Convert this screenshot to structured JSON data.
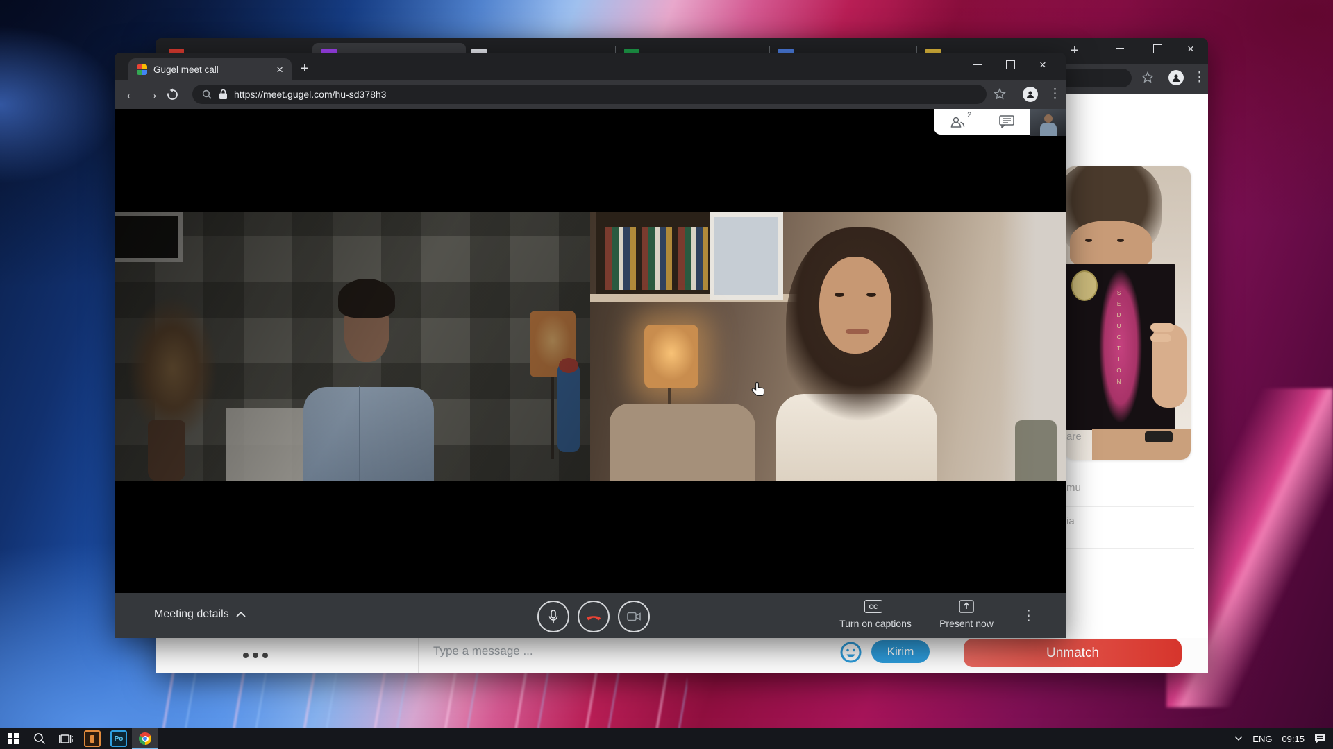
{
  "meet_window": {
    "tab_title": "Gugel meet call",
    "url": "https://meet.gugel.com/hu-sd378h3",
    "participants_count": "2",
    "bottom_bar": {
      "meeting_details_label": "Meeting details",
      "captions_label": "Turn on captions",
      "captions_icon_text": "CC",
      "present_label": "Present now"
    }
  },
  "back_window": {
    "tab_favicon_colors": [
      "#e03c31",
      "#a142f4",
      "#e8eaf0",
      "#1e9e4a",
      "#4b7de0",
      "#e0b93c"
    ],
    "profile_card": {
      "book_title": "SEDUCTION"
    },
    "list_items_clipped": [
      "are",
      "mu",
      "ia"
    ],
    "chat": {
      "typing_indicator_dots": 3,
      "message_placeholder": "Type a message ...",
      "send_label": "Kirim",
      "unmatch_label": "Unmatch"
    },
    "colors": {
      "send_blue": "#2D9CDB",
      "unmatch_red": "#DC4237"
    }
  },
  "taskbar": {
    "language": "ENG",
    "time": "09:15",
    "app_po_label": "Po",
    "app_icons": [
      "windows-start",
      "search",
      "task-view",
      "app-orange",
      "app-po",
      "chrome"
    ],
    "active_app": "chrome"
  },
  "glyphs": {
    "back_arrow": "←",
    "forward_arrow": "→",
    "tab_close": "×",
    "new_tab": "+",
    "kebab": "⋮"
  },
  "colors": {
    "browser_frame": "#202124",
    "browser_toolbar": "#35363a",
    "meet_bottom_bar": "#35383c",
    "hangup_red": "#ea4335",
    "wallpaper_dominant": [
      "#11306e",
      "#5b93e6",
      "#b81e55",
      "#7d1054"
    ]
  }
}
